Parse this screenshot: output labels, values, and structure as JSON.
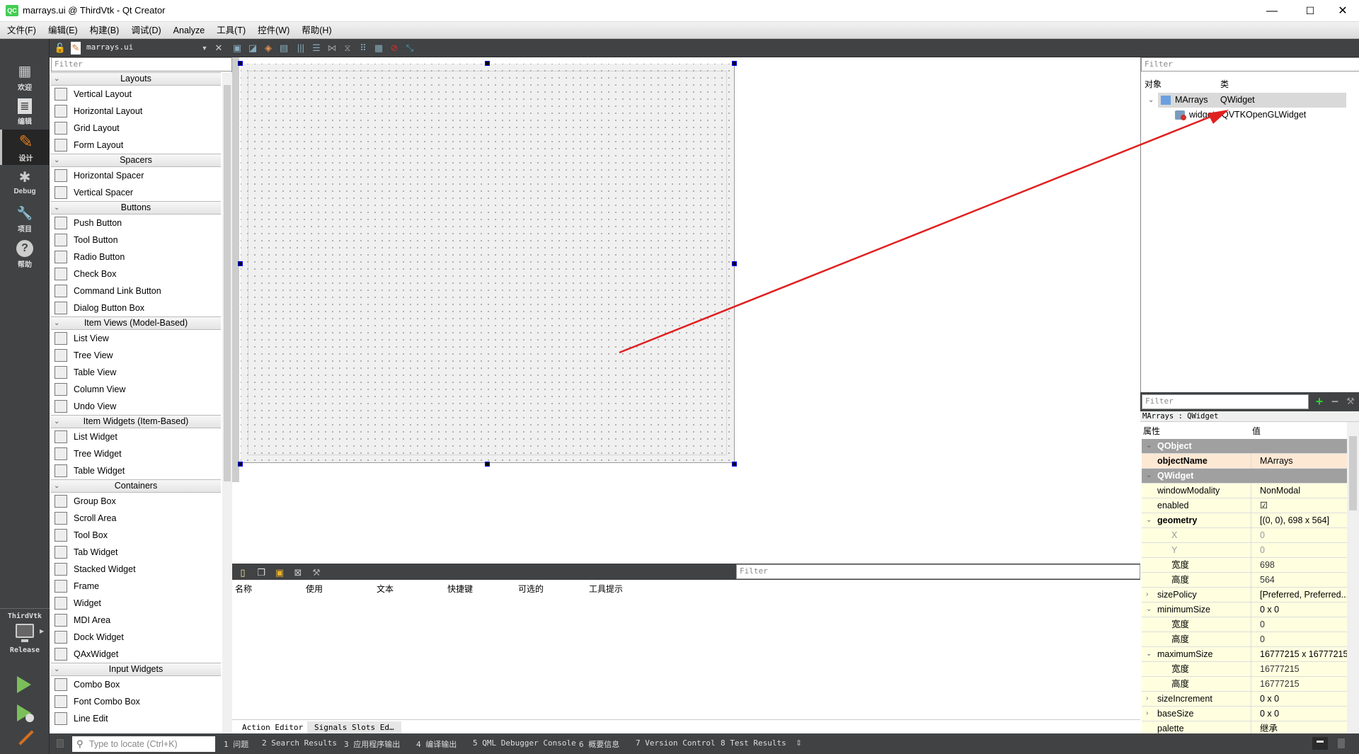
{
  "window": {
    "title": "marrays.ui @ ThirdVtk - Qt Creator",
    "app_icon": "QC",
    "minimize": "—",
    "maximize": "☐",
    "close": "✕"
  },
  "menu": [
    "文件(F)",
    "编辑(E)",
    "构建(B)",
    "调试(D)",
    "Analyze",
    "工具(T)",
    "控件(W)",
    "帮助(H)"
  ],
  "modes": [
    {
      "label": "欢迎",
      "icon": "grid-icon",
      "glyph": "▦"
    },
    {
      "label": "编辑",
      "icon": "edit-document-icon",
      "glyph": "≣"
    },
    {
      "label": "设计",
      "icon": "pencil-icon",
      "glyph": "✎",
      "active": true
    },
    {
      "label": "Debug",
      "icon": "bug-icon",
      "glyph": "✱"
    },
    {
      "label": "项目",
      "icon": "wrench-icon",
      "glyph": "🔧"
    },
    {
      "label": "帮助",
      "icon": "help-icon",
      "glyph": "?"
    }
  ],
  "kit": {
    "project": "ThirdVtk",
    "config": "Release"
  },
  "document": {
    "filename": "marrays.ui"
  },
  "widget_box": {
    "filter_placeholder": "Filter",
    "categories": [
      {
        "name": "Layouts",
        "items": [
          "Vertical Layout",
          "Horizontal Layout",
          "Grid Layout",
          "Form Layout"
        ]
      },
      {
        "name": "Spacers",
        "items": [
          "Horizontal Spacer",
          "Vertical Spacer"
        ]
      },
      {
        "name": "Buttons",
        "items": [
          "Push Button",
          "Tool Button",
          "Radio Button",
          "Check Box",
          "Command Link Button",
          "Dialog Button Box"
        ]
      },
      {
        "name": "Item Views (Model-Based)",
        "items": [
          "List View",
          "Tree View",
          "Table View",
          "Column View",
          "Undo View"
        ]
      },
      {
        "name": "Item Widgets (Item-Based)",
        "items": [
          "List Widget",
          "Tree Widget",
          "Table Widget"
        ]
      },
      {
        "name": "Containers",
        "items": [
          "Group Box",
          "Scroll Area",
          "Tool Box",
          "Tab Widget",
          "Stacked Widget",
          "Frame",
          "Widget",
          "MDI Area",
          "Dock Widget",
          "QAxWidget"
        ]
      },
      {
        "name": "Input Widgets",
        "items": [
          "Combo Box",
          "Font Combo Box",
          "Line Edit"
        ]
      }
    ]
  },
  "action_editor": {
    "filter_placeholder": "Filter",
    "columns": [
      "名称",
      "使用",
      "文本",
      "快捷键",
      "可选的",
      "工具提示"
    ],
    "tabs": [
      "Action Editor",
      "Signals  Slots Ed…"
    ]
  },
  "object_inspector": {
    "filter_placeholder": "Filter",
    "columns": [
      "对象",
      "类"
    ],
    "rows": [
      {
        "object": "MArrays",
        "class": "QWidget",
        "level": 0
      },
      {
        "object": "widget",
        "class": "QVTKOpenGLWidget",
        "level": 1
      }
    ]
  },
  "property_editor": {
    "filter_placeholder": "Filter",
    "class_label": "MArrays : QWidget",
    "columns": [
      "属性",
      "值"
    ],
    "rows": [
      {
        "type": "group",
        "name": "QObject"
      },
      {
        "type": "obj",
        "name": "objectName",
        "value": "MArrays",
        "bold": true
      },
      {
        "type": "group",
        "name": "QWidget"
      },
      {
        "type": "wid",
        "name": "windowModality",
        "value": "NonModal"
      },
      {
        "type": "wid",
        "name": "enabled",
        "value": "☑"
      },
      {
        "type": "wid",
        "name": "geometry",
        "value": "[(0, 0), 698 x 564]",
        "bold": true,
        "toggle": "open"
      },
      {
        "type": "sub",
        "name": "X",
        "value": "0",
        "grey": true
      },
      {
        "type": "sub",
        "name": "Y",
        "value": "0",
        "grey": true
      },
      {
        "type": "sub",
        "name": "宽度",
        "value": "698"
      },
      {
        "type": "sub",
        "name": "高度",
        "value": "564"
      },
      {
        "type": "wid",
        "name": "sizePolicy",
        "value": "[Preferred, Preferred...",
        "toggle": "closed"
      },
      {
        "type": "wid",
        "name": "minimumSize",
        "value": "0 x 0",
        "toggle": "open"
      },
      {
        "type": "sub",
        "name": "宽度",
        "value": "0"
      },
      {
        "type": "sub",
        "name": "高度",
        "value": "0"
      },
      {
        "type": "wid",
        "name": "maximumSize",
        "value": "16777215 x 16777215",
        "toggle": "open"
      },
      {
        "type": "sub",
        "name": "宽度",
        "value": "16777215"
      },
      {
        "type": "sub",
        "name": "高度",
        "value": "16777215"
      },
      {
        "type": "wid",
        "name": "sizeIncrement",
        "value": "0 x 0",
        "toggle": "closed"
      },
      {
        "type": "wid",
        "name": "baseSize",
        "value": "0 x 0",
        "toggle": "closed"
      },
      {
        "type": "wid",
        "name": "palette",
        "value": "继承"
      }
    ]
  },
  "status_bar": {
    "locator_placeholder": "Type to locate (Ctrl+K)",
    "panes": [
      "1 问题",
      "2 Search Results",
      "3 应用程序输出",
      "4 编译输出",
      "5 QML Debugger Console",
      "6 概要信息",
      "7 Version Control",
      "8 Test Results"
    ]
  },
  "annotation": {
    "color": "#e02020"
  }
}
